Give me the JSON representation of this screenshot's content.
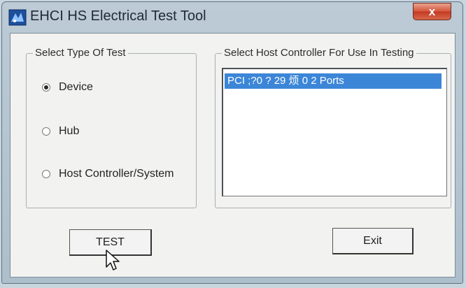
{
  "window": {
    "title": "EHCI HS Electrical Test Tool",
    "close_label": "x"
  },
  "test_type": {
    "legend": "Select Type Of Test",
    "options": [
      {
        "label": "Device",
        "selected": true
      },
      {
        "label": "Hub",
        "selected": false
      },
      {
        "label": "Host Controller/System",
        "selected": false
      }
    ]
  },
  "host_controller": {
    "legend": "Select Host Controller For Use In Testing",
    "items": [
      {
        "label": "PCI ;?0 ? 29 烦 0  2 Ports",
        "selected": true
      }
    ]
  },
  "buttons": {
    "test_label": "TEST",
    "exit_label": "Exit"
  },
  "icons": {
    "app": "usb-test-app-icon",
    "cursor": "mouse-pointer-icon"
  }
}
